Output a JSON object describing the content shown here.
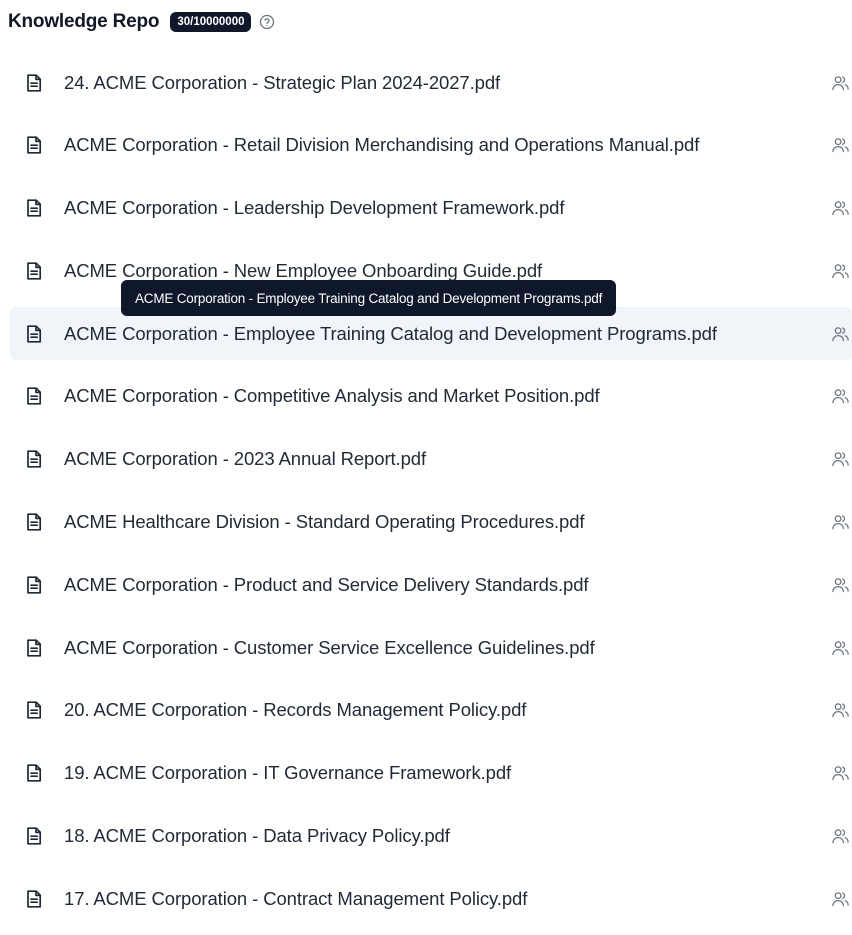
{
  "header": {
    "title": "Knowledge Repo",
    "count_badge": "30/10000000",
    "help_icon": "question-circle-icon"
  },
  "files": [
    {
      "name": "24. ACME Corporation - Strategic Plan 2024-2027.pdf",
      "icon": "document-icon",
      "action_icon": "users-icon"
    },
    {
      "name": "ACME Corporation - Retail Division Merchandising and Operations Manual.pdf",
      "icon": "document-icon",
      "action_icon": "users-icon"
    },
    {
      "name": "ACME Corporation - Leadership Development Framework.pdf",
      "icon": "document-icon",
      "action_icon": "users-icon"
    },
    {
      "name": "ACME Corporation - New Employee Onboarding Guide.pdf",
      "icon": "document-icon",
      "action_icon": "users-icon"
    },
    {
      "name": "ACME Corporation - Employee Training Catalog and Development Programs.pdf",
      "icon": "document-icon",
      "action_icon": "users-icon",
      "hovered": true
    },
    {
      "name": "ACME Corporation - Competitive Analysis and Market Position.pdf",
      "icon": "document-icon",
      "action_icon": "users-icon"
    },
    {
      "name": "ACME Corporation - 2023 Annual Report.pdf",
      "icon": "document-icon",
      "action_icon": "users-icon"
    },
    {
      "name": "ACME Healthcare Division - Standard Operating Procedures.pdf",
      "icon": "document-icon",
      "action_icon": "users-icon"
    },
    {
      "name": "ACME Corporation - Product and Service Delivery Standards.pdf",
      "icon": "document-icon",
      "action_icon": "users-icon"
    },
    {
      "name": "ACME Corporation - Customer Service Excellence Guidelines.pdf",
      "icon": "document-icon",
      "action_icon": "users-icon"
    },
    {
      "name": "20. ACME Corporation - Records Management Policy.pdf",
      "icon": "document-icon",
      "action_icon": "users-icon"
    },
    {
      "name": "19. ACME Corporation - IT Governance Framework.pdf",
      "icon": "document-icon",
      "action_icon": "users-icon"
    },
    {
      "name": "18. ACME Corporation - Data Privacy Policy.pdf",
      "icon": "document-icon",
      "action_icon": "users-icon"
    },
    {
      "name": "17. ACME Corporation - Contract Management Policy.pdf",
      "icon": "document-icon",
      "action_icon": "users-icon"
    }
  ],
  "tooltip": {
    "text": "ACME Corporation - Employee Training Catalog and Development Programs.pdf"
  }
}
